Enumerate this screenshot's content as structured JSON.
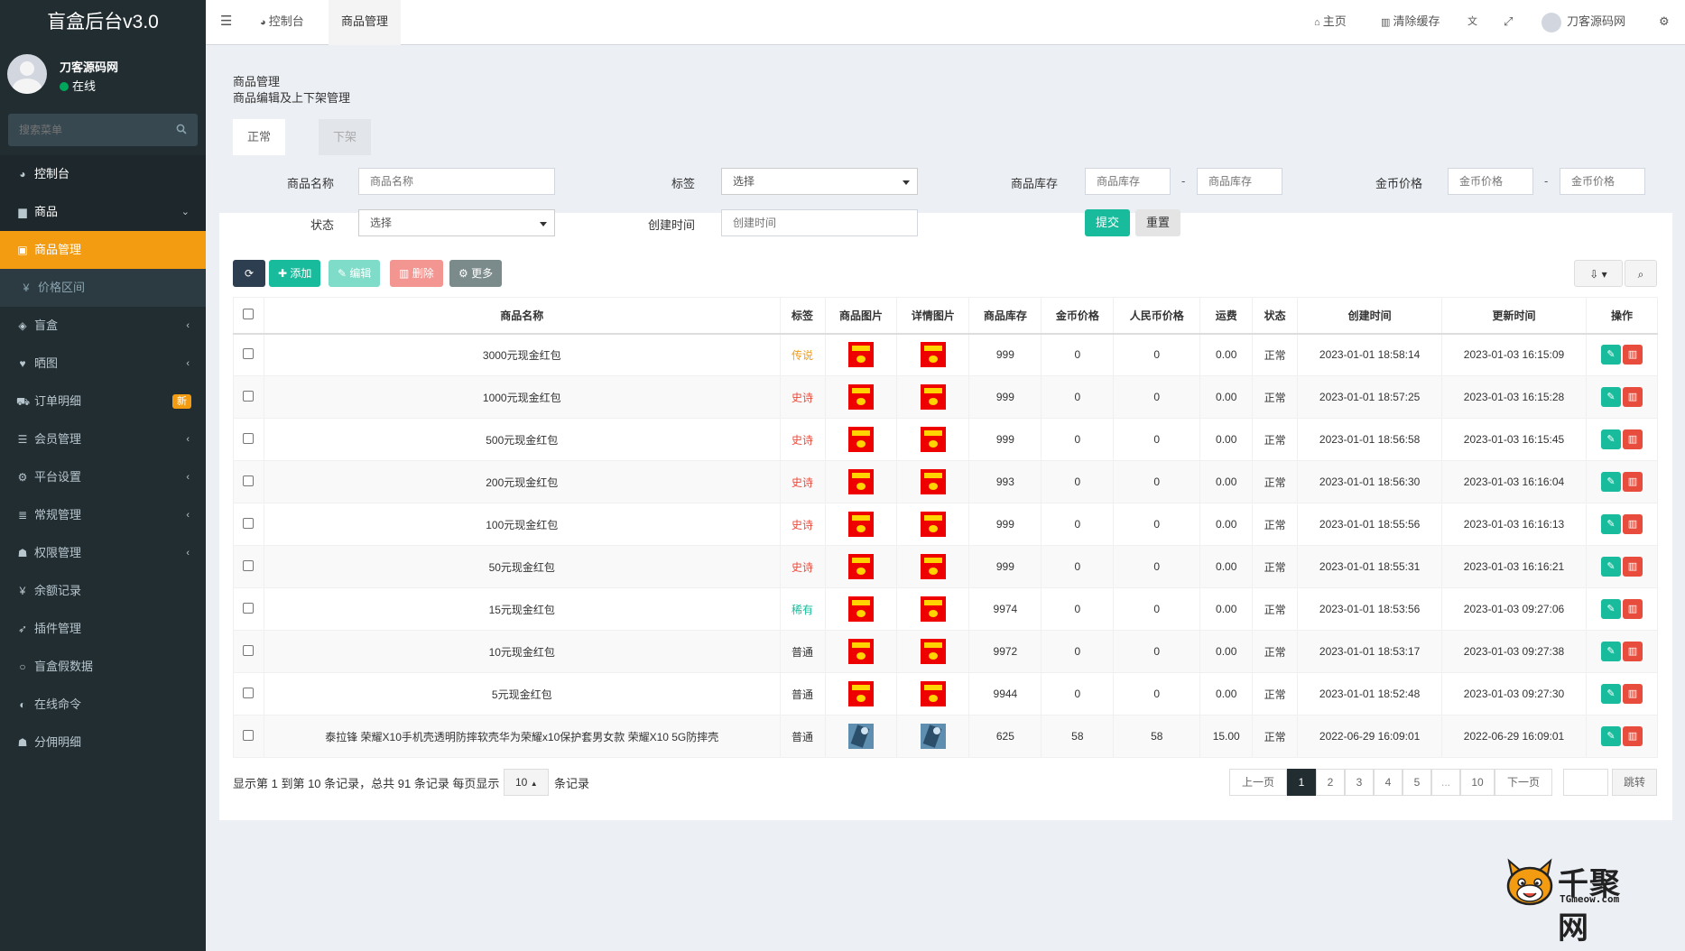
{
  "app": {
    "brand": "盲盒后台v3.0"
  },
  "user": {
    "name": "刀客源码网",
    "status": "在线"
  },
  "sidebar": {
    "search_placeholder": "搜索菜单",
    "items": [
      {
        "label": "控制台",
        "icon": "dashboard-icon"
      },
      {
        "label": "商品",
        "icon": "shopping-bag-icon"
      },
      {
        "label": "商品管理",
        "icon": "gift-icon"
      },
      {
        "label": "价格区间",
        "icon": "yen-icon"
      },
      {
        "label": "盲盒",
        "icon": "cube-icon"
      },
      {
        "label": "晒图",
        "icon": "heart-icon"
      },
      {
        "label": "订单明细",
        "icon": "cart-icon",
        "badge": "新"
      },
      {
        "label": "会员管理",
        "icon": "list-icon"
      },
      {
        "label": "平台设置",
        "icon": "gear-icon"
      },
      {
        "label": "常规管理",
        "icon": "database-icon"
      },
      {
        "label": "权限管理",
        "icon": "group-icon"
      },
      {
        "label": "余额记录",
        "icon": "yen-icon"
      },
      {
        "label": "插件管理",
        "icon": "rocket-icon"
      },
      {
        "label": "盲盒假数据",
        "icon": "circle-icon"
      },
      {
        "label": "在线命令",
        "icon": "adjust-icon"
      },
      {
        "label": "分佣明细",
        "icon": "group-icon"
      }
    ]
  },
  "topbar": {
    "dashboard_tab": "控制台",
    "active_tab": "商品管理",
    "home": "主页",
    "clear_cache": "清除缓存",
    "username": "刀客源码网"
  },
  "page": {
    "title": "商品管理",
    "subtitle": "商品编辑及上下架管理",
    "tabs": [
      "正常",
      "下架"
    ]
  },
  "filters": {
    "name_label": "商品名称",
    "name_placeholder": "商品名称",
    "tag_label": "标签",
    "tag_value": "选择",
    "stock_label": "商品库存",
    "stock_placeholder": "商品库存",
    "gold_label": "金币价格",
    "gold_placeholder": "金币价格",
    "status_label": "状态",
    "status_value": "选择",
    "created_label": "创建时间",
    "created_placeholder": "创建时间",
    "submit": "提交",
    "reset": "重置"
  },
  "toolbar": {
    "add": "添加",
    "edit": "编辑",
    "delete": "删除",
    "more": "更多"
  },
  "table": {
    "columns": [
      "商品名称",
      "标签",
      "商品图片",
      "详情图片",
      "商品库存",
      "金币价格",
      "人民币价格",
      "运费",
      "状态",
      "创建时间",
      "更新时间",
      "操作"
    ],
    "rows": [
      {
        "name": "3000元现金红包",
        "tag": "传说",
        "tag_type": "legend",
        "stock": "999",
        "gold": "0",
        "rmb": "0",
        "freight": "0.00",
        "status": "正常",
        "created": "2023-01-01 18:58:14",
        "updated": "2023-01-03 16:15:09",
        "img": "red-packet"
      },
      {
        "name": "1000元现金红包",
        "tag": "史诗",
        "tag_type": "epic",
        "stock": "999",
        "gold": "0",
        "rmb": "0",
        "freight": "0.00",
        "status": "正常",
        "created": "2023-01-01 18:57:25",
        "updated": "2023-01-03 16:15:28",
        "img": "red-packet"
      },
      {
        "name": "500元现金红包",
        "tag": "史诗",
        "tag_type": "epic",
        "stock": "999",
        "gold": "0",
        "rmb": "0",
        "freight": "0.00",
        "status": "正常",
        "created": "2023-01-01 18:56:58",
        "updated": "2023-01-03 16:15:45",
        "img": "red-packet"
      },
      {
        "name": "200元现金红包",
        "tag": "史诗",
        "tag_type": "epic",
        "stock": "993",
        "gold": "0",
        "rmb": "0",
        "freight": "0.00",
        "status": "正常",
        "created": "2023-01-01 18:56:30",
        "updated": "2023-01-03 16:16:04",
        "img": "red-packet"
      },
      {
        "name": "100元现金红包",
        "tag": "史诗",
        "tag_type": "epic",
        "stock": "999",
        "gold": "0",
        "rmb": "0",
        "freight": "0.00",
        "status": "正常",
        "created": "2023-01-01 18:55:56",
        "updated": "2023-01-03 16:16:13",
        "img": "red-packet"
      },
      {
        "name": "50元现金红包",
        "tag": "史诗",
        "tag_type": "epic",
        "stock": "999",
        "gold": "0",
        "rmb": "0",
        "freight": "0.00",
        "status": "正常",
        "created": "2023-01-01 18:55:31",
        "updated": "2023-01-03 16:16:21",
        "img": "red-packet"
      },
      {
        "name": "15元现金红包",
        "tag": "稀有",
        "tag_type": "rare",
        "stock": "9974",
        "gold": "0",
        "rmb": "0",
        "freight": "0.00",
        "status": "正常",
        "created": "2023-01-01 18:53:56",
        "updated": "2023-01-03 09:27:06",
        "img": "red-packet"
      },
      {
        "name": "10元现金红包",
        "tag": "普通",
        "tag_type": "normal",
        "stock": "9972",
        "gold": "0",
        "rmb": "0",
        "freight": "0.00",
        "status": "正常",
        "created": "2023-01-01 18:53:17",
        "updated": "2023-01-03 09:27:38",
        "img": "red-packet"
      },
      {
        "name": "5元现金红包",
        "tag": "普通",
        "tag_type": "normal",
        "stock": "9944",
        "gold": "0",
        "rmb": "0",
        "freight": "0.00",
        "status": "正常",
        "created": "2023-01-01 18:52:48",
        "updated": "2023-01-03 09:27:30",
        "img": "red-packet"
      },
      {
        "name": "泰拉锋 荣耀X10手机壳透明防摔软壳华为荣耀x10保护套男女款 荣耀X10 5G防摔壳",
        "tag": "普通",
        "tag_type": "normal",
        "stock": "625",
        "gold": "58",
        "rmb": "58",
        "freight": "15.00",
        "status": "正常",
        "created": "2022-06-29 16:09:01",
        "updated": "2022-06-29 16:09:01",
        "img": "photo"
      }
    ]
  },
  "pagination": {
    "info_before": "显示第 1 到第 10 条记录，总共 91 条记录 每页显示",
    "page_size": "10",
    "info_after": "条记录",
    "prev": "上一页",
    "pages": [
      "1",
      "2",
      "3",
      "4",
      "5",
      "...",
      "10"
    ],
    "next": "下一页",
    "jump": "跳转"
  },
  "watermark": {
    "text": "千聚网",
    "sub": "TGmeow.com"
  },
  "colors": {
    "sidebar": "#222d32",
    "accent": "#f39c12",
    "success": "#18bc9c",
    "danger": "#e74c3c"
  }
}
